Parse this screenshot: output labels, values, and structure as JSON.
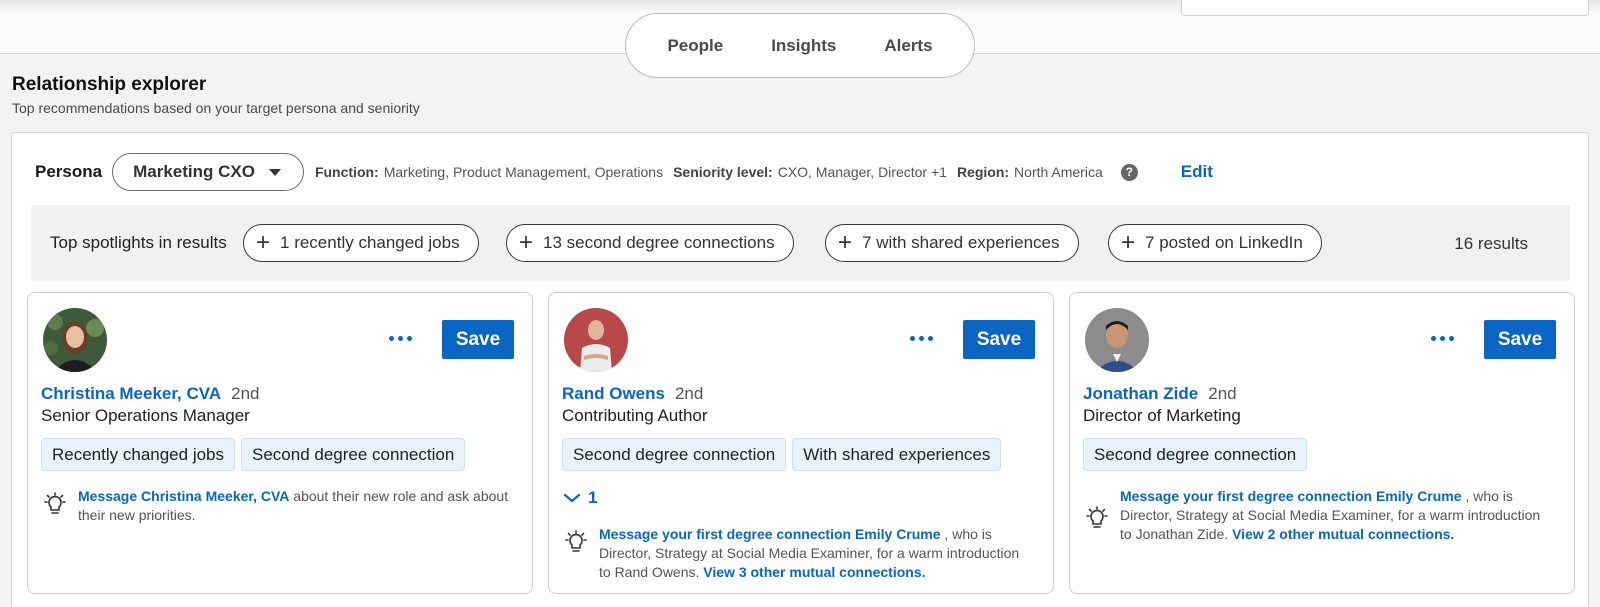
{
  "nav": {
    "tabs": [
      "People",
      "Insights",
      "Alerts"
    ]
  },
  "header": {
    "title": "Relationship explorer",
    "subtitle": "Top recommendations based on your target persona and seniority"
  },
  "persona": {
    "label": "Persona",
    "selected": "Marketing CXO",
    "function_label": "Function:",
    "function_value": "Marketing, Product Management, Operations",
    "seniority_label": "Seniority level:",
    "seniority_value": "CXO, Manager, Director +1",
    "region_label": "Region:",
    "region_value": "North America",
    "help_glyph": "?",
    "edit_label": "Edit"
  },
  "spotlights": {
    "label": "Top spotlights in results",
    "chips": [
      "1 recently changed jobs",
      "13 second degree connections",
      "7 with shared experiences",
      "7 posted on LinkedIn"
    ],
    "results": "16 results"
  },
  "cards": [
    {
      "name": "Christina Meeker, CVA",
      "degree": "2nd",
      "title": "Senior Operations Manager",
      "tags": [
        "Recently changed jobs",
        "Second degree connection"
      ],
      "save_label": "Save",
      "insight_link": "Message Christina Meeker, CVA",
      "insight_text": " about their new role and ask about their new priorities."
    },
    {
      "name": "Rand Owens",
      "degree": "2nd",
      "title": "Contributing Author",
      "tags": [
        "Second degree connection",
        "With shared experiences"
      ],
      "save_label": "Save",
      "expand_count": "1",
      "insight_link": "Message your first degree connection Emily Crume",
      "insight_text": " , who is Director, Strategy at Social Media Examiner, for a warm introduction to Rand Owens. ",
      "insight_link2": "View 3 other mutual connections."
    },
    {
      "name": "Jonathan Zide",
      "degree": "2nd",
      "title": "Director of Marketing",
      "tags": [
        "Second degree connection"
      ],
      "save_label": "Save",
      "insight_link": "Message your first degree connection Emily Crume",
      "insight_text": " , who is Director, Strategy at Social Media Examiner, for a warm introduction to Jonathan Zide. ",
      "insight_link2": "View 2 other mutual connections."
    }
  ],
  "colors": {
    "accent": "#0a66c2",
    "tag_bg": "#e8f3fb"
  },
  "icons": [
    "help-icon",
    "caret-down-icon",
    "plus-icon",
    "more-dots-icon",
    "chevron-down-icon",
    "lightbulb-icon"
  ]
}
